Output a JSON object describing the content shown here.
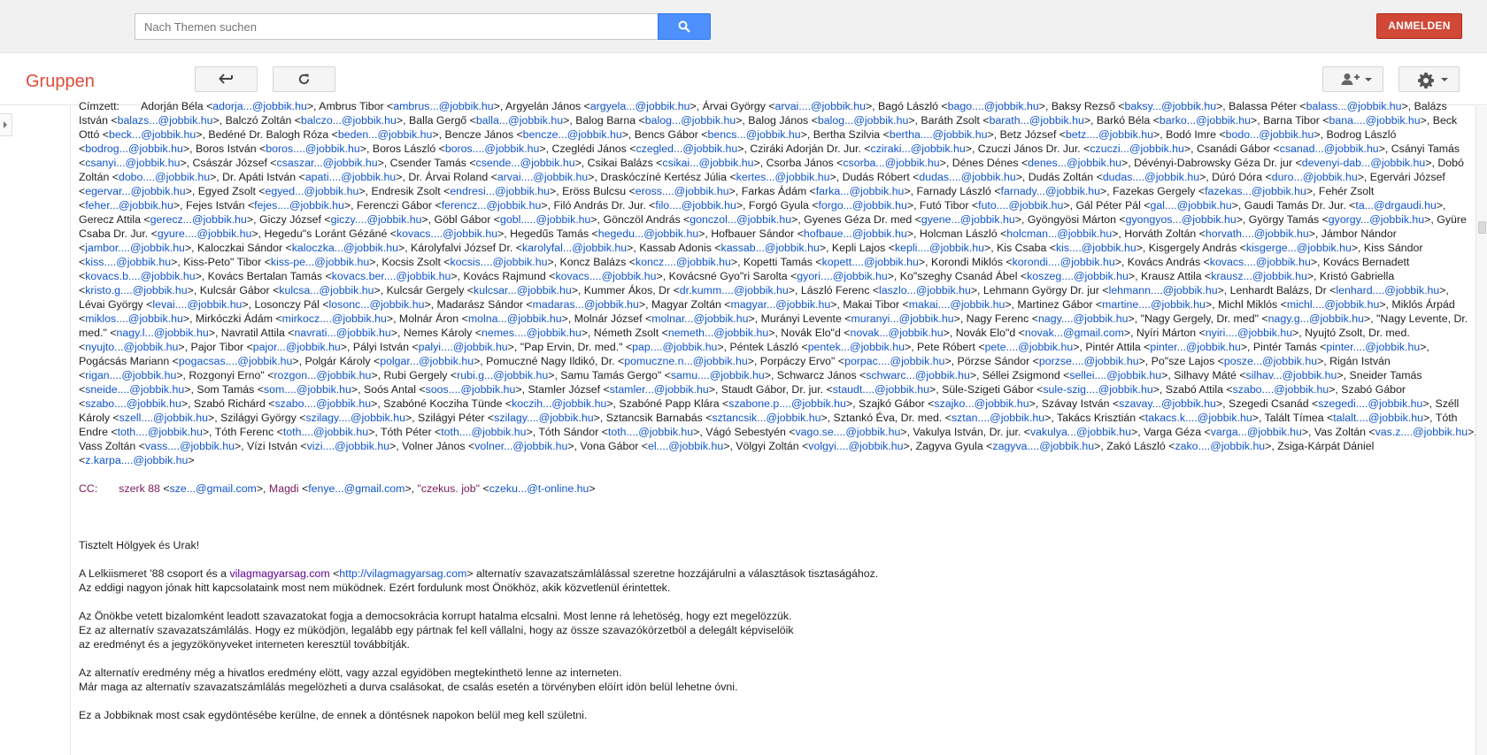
{
  "header": {
    "search_placeholder": "Nach Themen suchen",
    "signin_label": "ANMELDEN"
  },
  "toolbar": {
    "brand": "Gruppen"
  },
  "email": {
    "to_label": "Címzett:",
    "recipients_html": "<span class=\"nm\">Adorján Béla</span> &lt;<a>adorja...@jobbik.hu</a>&gt;, Ambrus Tibor &lt;<a>ambrus...@jobbik.hu</a>&gt;, Argyelán János &lt;<a>argyela...@jobbik.hu</a>&gt;, Árvai György &lt;<a>arvai....@jobbik.hu</a>&gt;, Bagó László &lt;<a>bago....@jobbik.hu</a>&gt;, Baksy Rezső &lt;<a>baksy...@jobbik.hu</a>&gt;, Balassa Péter &lt;<a>balass...@jobbik.hu</a>&gt;, Balázs István &lt;<a>balazs...@jobbik.hu</a>&gt;, Balczó Zoltán &lt;<a>balczo...@jobbik.hu</a>&gt;, Balla Gergő &lt;<a>balla...@jobbik.hu</a>&gt;, Balog Barna &lt;<a>balog...@jobbik.hu</a>&gt;, Balog János &lt;<a>balog...@jobbik.hu</a>&gt;, Baráth Zsolt &lt;<a>barath...@jobbik.hu</a>&gt;, Barkó Béla &lt;<a>barko...@jobbik.hu</a>&gt;, Barna Tibor &lt;<a>bana....@jobbik.hu</a>&gt;, Beck Ottó &lt;<a>beck...@jobbik.hu</a>&gt;, Bedéné Dr. Balogh Róza &lt;<a>beden...@jobbik.hu</a>&gt;, Bencze János &lt;<a>bencze...@jobbik.hu</a>&gt;, Bencs Gábor &lt;<a>bencs...@jobbik.hu</a>&gt;, Bertha Szilvia &lt;<a>bertha....@jobbik.hu</a>&gt;, Betz József &lt;<a>betz....@jobbik.hu</a>&gt;, Bodó Imre &lt;<a>bodo...@jobbik.hu</a>&gt;, Bodrog László &lt;<a>bodrog...@jobbik.hu</a>&gt;, Boros István &lt;<a>boros....@jobbik.hu</a>&gt;, Boros László &lt;<a>boros....@jobbik.hu</a>&gt;, Czeglédi János &lt;<a>czegled...@jobbik.hu</a>&gt;, Cziráki Adorján Dr. Jur. &lt;<a>cziraki...@jobbik.hu</a>&gt;, Czuczi János Dr. Jur. &lt;<a>czuczi...@jobbik.hu</a>&gt;, Csanádi Gábor &lt;<a>csanad...@jobbik.hu</a>&gt;, Csányi Tamás &lt;<a>csanyi...@jobbik.hu</a>&gt;, Császár József &lt;<a>csaszar...@jobbik.hu</a>&gt;, Csender Tamás &lt;<a>csende...@jobbik.hu</a>&gt;, Csikai Balázs &lt;<a>csikai...@jobbik.hu</a>&gt;, Csorba János &lt;<a>csorba...@jobbik.hu</a>&gt;, Dénes Dénes &lt;<a>denes...@jobbik.hu</a>&gt;, Dévényi-Dabrowsky Géza Dr. jur &lt;<a>devenyi-dab...@jobbik.hu</a>&gt;, Dobó Zoltán &lt;<a>dobo....@jobbik.hu</a>&gt;, Dr. Apáti István &lt;<a>apati....@jobbik.hu</a>&gt;, Dr. Árvai Roland &lt;<a>arvai....@jobbik.hu</a>&gt;, Draskóczíné Kertész Júlia &lt;<a>kertes...@jobbik.hu</a>&gt;, Dudás Róbert &lt;<a>dudas....@jobbik.hu</a>&gt;, Dudás Zoltán &lt;<a>dudas....@jobbik.hu</a>&gt;, Dúró Dóra &lt;<a>duro...@jobbik.hu</a>&gt;, Egervári József &lt;<a>egervar...@jobbik.hu</a>&gt;, Egyed Zsolt &lt;<a>egyed...@jobbik.hu</a>&gt;, Endresik Zsolt &lt;<a>endresi...@jobbik.hu</a>&gt;, Eröss Bulcsu &lt;<a>eross....@jobbik.hu</a>&gt;, Farkas Ádám &lt;<a>farka...@jobbik.hu</a>&gt;, Farnady László &lt;<a>farnady...@jobbik.hu</a>&gt;, Fazekas Gergely &lt;<a>fazekas...@jobbik.hu</a>&gt;, Fehér Zsolt &lt;<a>feher...@jobbik.hu</a>&gt;, Fejes István &lt;<a>fejes....@jobbik.hu</a>&gt;, Ferenczi Gábor &lt;<a>ferencz...@jobbik.hu</a>&gt;, Filó András Dr. Jur. &lt;<a>filo....@jobbik.hu</a>&gt;, Forgó Gyula &lt;<a>forgo...@jobbik.hu</a>&gt;, Futó Tibor &lt;<a>futo....@jobbik.hu</a>&gt;, Gál Péter Pál &lt;<a>gal....@jobbik.hu</a>&gt;, Gaudi Tamás Dr. Jur. &lt;<a>ta...@drgaudi.hu</a>&gt;, Gerecz Attila &lt;<a>gerecz...@jobbik.hu</a>&gt;, Giczy József &lt;<a>giczy....@jobbik.hu</a>&gt;, Göbl Gábor &lt;<a>gobl.....@jobbik.hu</a>&gt;, Gönczöl András &lt;<a>gonczol...@jobbik.hu</a>&gt;, Gyenes Géza Dr. med &lt;<a>gyene...@jobbik.hu</a>&gt;, Gyöngyösi Márton &lt;<a>gyongyos...@jobbik.hu</a>&gt;, György Tamás &lt;<a>gyorgy...@jobbik.hu</a>&gt;, Gyüre Csaba Dr. Jur. &lt;<a>gyure....@jobbik.hu</a>&gt;, Hegedu\"s Loránt Gézáné &lt;<a>kovacs....@jobbik.hu</a>&gt;, Hegedűs Tamás &lt;<a>hegedu...@jobbik.hu</a>&gt;, Hofbauer Sándor &lt;<a>hofbaue...@jobbik.hu</a>&gt;, Holcman László &lt;<a>holcman...@jobbik.hu</a>&gt;, Horváth Zoltán &lt;<a>horvath....@jobbik.hu</a>&gt;, Jámbor Nándor &lt;<a>jambor....@jobbik.hu</a>&gt;, Kaloczkai Sándor &lt;<a>kaloczka...@jobbik.hu</a>&gt;, Károlyfalvi József Dr. &lt;<a>karolyfal...@jobbik.hu</a>&gt;, Kassab Adonis &lt;<a>kassab...@jobbik.hu</a>&gt;, Kepli Lajos &lt;<a>kepli....@jobbik.hu</a>&gt;, Kis Csaba &lt;<a>kis....@jobbik.hu</a>&gt;, Kisgergely András &lt;<a>kisgerge...@jobbik.hu</a>&gt;, Kiss Sándor &lt;<a>kiss....@jobbik.hu</a>&gt;, Kiss-Peto\" Tibor &lt;<a>kiss-pe...@jobbik.hu</a>&gt;, Kocsis Zsolt &lt;<a>kocsis....@jobbik.hu</a>&gt;, Koncz Balázs &lt;<a>koncz....@jobbik.hu</a>&gt;, Kopetti Tamás &lt;<a>kopett....@jobbik.hu</a>&gt;, Korondi Miklós &lt;<a>korondi....@jobbik.hu</a>&gt;, Kovács András &lt;<a>kovacs....@jobbik.hu</a>&gt;, Kovács Bernadett &lt;<a>kovacs.b....@jobbik.hu</a>&gt;, Kovács Bertalan Tamás &lt;<a>kovacs.ber....@jobbik.hu</a>&gt;, Kovács Rajmund &lt;<a>kovacs....@jobbik.hu</a>&gt;, Kovácsné Gyo\"ri Sarolta &lt;<a>gyori....@jobbik.hu</a>&gt;, Ko\"szeghy Csanád Ábel &lt;<a>koszeg....@jobbik.hu</a>&gt;, Krausz Attila &lt;<a>krausz...@jobbik.hu</a>&gt;, Kristó Gabriella &lt;<a>kristo.g....@jobbik.hu</a>&gt;, Kulcsár Gábor &lt;<a>kulcsa...@jobbik.hu</a>&gt;, Kulcsár Gergely &lt;<a>kulcsar...@jobbik.hu</a>&gt;, Kummer Ákos, Dr &lt;<a>dr.kumm....@jobbik.hu</a>&gt;, László Ferenc &lt;<a>laszlo...@jobbik.hu</a>&gt;, Lehmann György Dr. jur &lt;<a>lehmann....@jobbik.hu</a>&gt;, Lenhardt Balázs, Dr &lt;<a>lenhard....@jobbik.hu</a>&gt;, Lévai György &lt;<a>levai....@jobbik.hu</a>&gt;, Losonczy Pál &lt;<a>losonc...@jobbik.hu</a>&gt;, Madarász Sándor &lt;<a>madaras...@jobbik.hu</a>&gt;, Magyar Zoltán &lt;<a>magyar...@jobbik.hu</a>&gt;, Makai Tibor &lt;<a>makai....@jobbik.hu</a>&gt;, Martinez Gábor &lt;<a>martine....@jobbik.hu</a>&gt;, Michl Miklós &lt;<a>michl....@jobbik.hu</a>&gt;, Miklós Árpád &lt;<a>miklos....@jobbik.hu</a>&gt;, Mirkóczki Ádám &lt;<a>mirkocz....@jobbik.hu</a>&gt;, Molnár Áron &lt;<a>molna...@jobbik.hu</a>&gt;, Molnár József &lt;<a>molnar...@jobbik.hu</a>&gt;, Murányi Levente &lt;<a>muranyi...@jobbik.hu</a>&gt;, Nagy Ferenc &lt;<a>nagy....@jobbik.hu</a>&gt;, \"Nagy Gergely, Dr. med\" &lt;<a>nagy.g...@jobbik.hu</a>&gt;, \"Nagy Levente, Dr. med.\" &lt;<a>nagy.l...@jobbik.hu</a>&gt;, Navratil Attila &lt;<a>navrati...@jobbik.hu</a>&gt;, Nemes Károly &lt;<a>nemes....@jobbik.hu</a>&gt;, Németh Zsolt &lt;<a>nemeth...@jobbik.hu</a>&gt;, Novák Elo\"d &lt;<a>novak...@jobbik.hu</a>&gt;, Novák Elo\"d &lt;<a>novak...@gmail.com</a>&gt;, Nyíri Márton &lt;<a>nyiri....@jobbik.hu</a>&gt;, Nyujtó Zsolt, Dr. med. &lt;<a>nyujto...@jobbik.hu</a>&gt;, Pajor Tibor &lt;<a>pajor...@jobbik.hu</a>&gt;, Pályi István &lt;<a>palyi....@jobbik.hu</a>&gt;, \"Pap Ervin, Dr. med.\" &lt;<a>pap....@jobbik.hu</a>&gt;, Péntek László &lt;<a>pentek...@jobbik.hu</a>&gt;, Pete Róbert &lt;<a>pete....@jobbik.hu</a>&gt;, Pintér Attila &lt;<a>pinter...@jobbik.hu</a>&gt;, Pintér Tamás &lt;<a>pinter....@jobbik.hu</a>&gt;, Pogácsás Mariann &lt;<a>pogacsas....@jobbik.hu</a>&gt;, Polgár Károly &lt;<a>polgar...@jobbik.hu</a>&gt;, Pomuczné Nagy Ildikó, Dr. &lt;<a>pomuczne.n...@jobbik.hu</a>&gt;, Porpáczy Ervo\" &lt;<a>porpac....@jobbik.hu</a>&gt;, Pörzse Sándor &lt;<a>porzse....@jobbik.hu</a>&gt;, Po\"sze Lajos &lt;<a>posze...@jobbik.hu</a>&gt;, Rigán István &lt;<a>rigan....@jobbik.hu</a>&gt;, Rozgonyi Erno\" &lt;<a>rozgon...@jobbik.hu</a>&gt;, Rubi Gergely &lt;<a>rubi.g...@jobbik.hu</a>&gt;, Samu Tamás Gergo\" &lt;<a>samu....@jobbik.hu</a>&gt;, Schwarcz János &lt;<a>schwarc...@jobbik.hu</a>&gt;, Séllei Zsigmond &lt;<a>sellei....@jobbik.hu</a>&gt;, Silhavy Máté &lt;<a>silhav...@jobbik.hu</a>&gt;, Sneider Tamás &lt;<a>sneide....@jobbik.hu</a>&gt;, Som Tamás &lt;<a>som....@jobbik.hu</a>&gt;, Soós Antal &lt;<a>soos....@jobbik.hu</a>&gt;, Stamler József &lt;<a>stamler...@jobbik.hu</a>&gt;, Staudt Gábor, Dr. jur. &lt;<a>staudt....@jobbik.hu</a>&gt;, Süle-Szigeti Gábor &lt;<a>sule-szig....@jobbik.hu</a>&gt;, Szabó Attila &lt;<a>szabo....@jobbik.hu</a>&gt;, Szabó Gábor &lt;<a>szabo....@jobbik.hu</a>&gt;, Szabó Richárd &lt;<a>szabo....@jobbik.hu</a>&gt;, Szabóné Kocziha Tünde &lt;<a>koczih...@jobbik.hu</a>&gt;, Szabóné Papp Klára &lt;<a>szabone.p....@jobbik.hu</a>&gt;, Szajkó Gábor &lt;<a>szajko...@jobbik.hu</a>&gt;, Szávay István &lt;<a>szavay...@jobbik.hu</a>&gt;, Szegedi Csanád &lt;<a>szegedi....@jobbik.hu</a>&gt;, Széll Károly &lt;<a>szell....@jobbik.hu</a>&gt;, Szilágyi György &lt;<a>szilagy....@jobbik.hu</a>&gt;, Szilágyi Péter &lt;<a>szilagy....@jobbik.hu</a>&gt;, Sztancsik Barnabás &lt;<a>sztancsik...@jobbik.hu</a>&gt;, Sztankó Éva, Dr. med. &lt;<a>sztan....@jobbik.hu</a>&gt;, Takács Krisztián &lt;<a>takacs.k....@jobbik.hu</a>&gt;, Talált Tímea &lt;<a>talalt....@jobbik.hu</a>&gt;, Tóth Endre &lt;<a>toth....@jobbik.hu</a>&gt;, Tóth Ferenc &lt;<a>toth....@jobbik.hu</a>&gt;, Tóth Péter &lt;<a>toth....@jobbik.hu</a>&gt;, Tóth Sándor &lt;<a>toth....@jobbik.hu</a>&gt;, Vágó Sebestyén &lt;<a>vago.se....@jobbik.hu</a>&gt;, Vakulya István, Dr. jur. &lt;<a>vakulya...@jobbik.hu</a>&gt;, Varga Géza &lt;<a>varga...@jobbik.hu</a>&gt;, Vas Zoltán &lt;<a>vas.z....@jobbik.hu</a>&gt;, Vass Zoltán &lt;<a>vass....@jobbik.hu</a>&gt;, Vízi István &lt;<a>vizi....@jobbik.hu</a>&gt;, Volner János &lt;<a>volner...@jobbik.hu</a>&gt;, Vona Gábor &lt;<a>el....@jobbik.hu</a>&gt;, Völgyi Zoltán &lt;<a>volgyi....@jobbik.hu</a>&gt;, Zagyva Gyula &lt;<a>zagyva....@jobbik.hu</a>&gt;, Zakó László &lt;<a>zako....@jobbik.hu</a>&gt;, Zsiga-Kárpát Dániel &lt;<a>z.karpa....@jobbik.hu</a>&gt;",
    "cc_label": "CC:",
    "cc_html": "<span class=\"nm\">szerk 88</span> &lt;<a>sze...@gmail.com</a>&gt;, <span class=\"nm\">Magdi</span> &lt;<a>fenye...@gmail.com</a>&gt;, <span class=\"nm\">\"czekus. job\"</span> &lt;<a>czeku...@t-online.hu</a>&gt;",
    "greeting": "Tisztelt Hölgyek és Urak!",
    "para1_html": "A Lelkiismeret '88 csoport és a <a class=\"visited\">vilagmagyarsag.com</a> &lt;<a>http://vilagmagyarsag.com</a>&gt; alternatív szavazatszámlálással szeretne hozzájárulni a választások tisztaságához.<br>Az eddigi nagyon jónak hitt kapcsolataink most nem müködnek. Ezért fordulunk most Önökhöz, akik közvetlenül érintettek.",
    "para2_html": "Az Önökbe vetett bizalomként leadott szavazatokat fogja a democsokrácia korrupt hatalma elcsalni. Most lenne rá lehetöség, hogy ezt megelözzük.<br>Ez az alternatív szavazatszámlálás. Hogy ez müködjön, legalább egy pártnak fel kell vállalni, hogy az össze szavazókörzetböl a delegált képviselöik<br>az eredményt és a jegyzökönyveket interneten keresztül továbbítják.",
    "para3_html": "Az alternatív eredmény még a hivatlos eredmény elött, vagy azzal egyidöben megtekinthetö lenne az interneten.<br>Már maga az alternatív szavazatszámlálás megelözheti a durva csalásokat, de csalás esetén a törvényben elöírt idön belül lehetne óvni.",
    "para4_html": "Ez a Jobbiknak most csak egydöntésébe kerülne, de ennek a döntésnek napokon belül meg kell születni."
  }
}
